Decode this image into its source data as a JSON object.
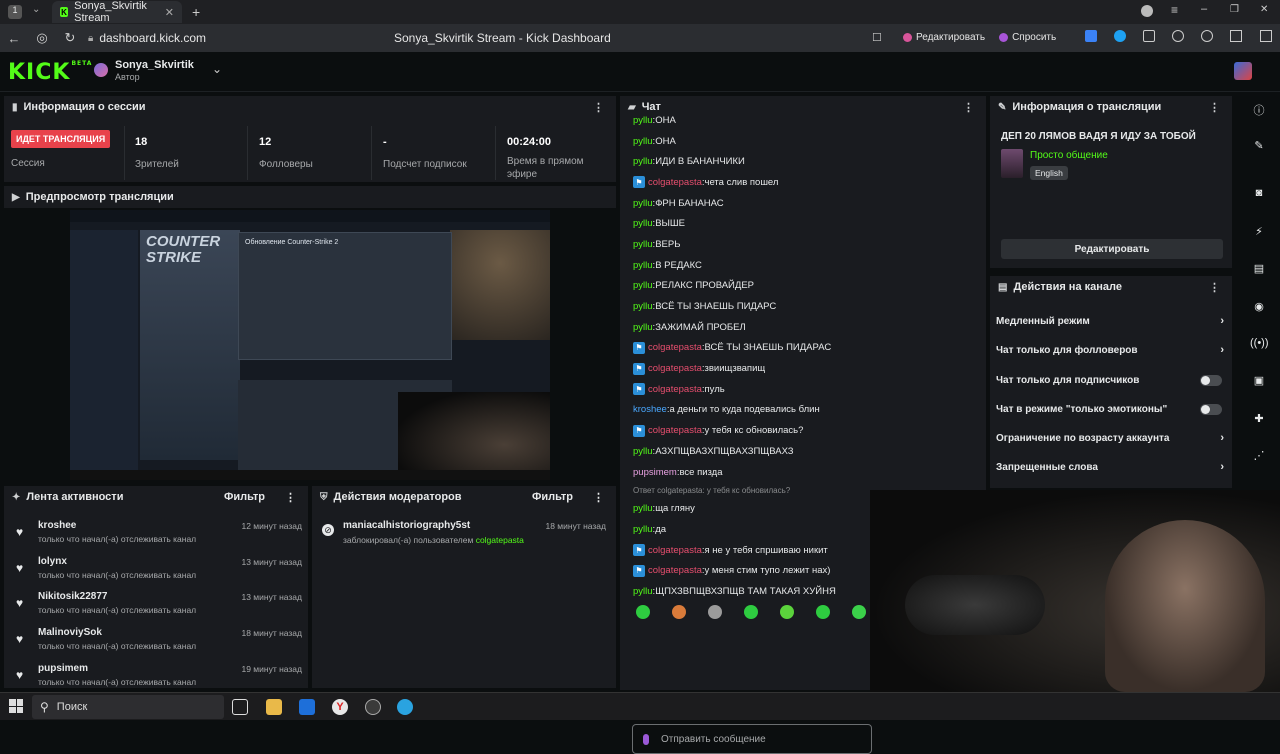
{
  "browser": {
    "tab_title": "Sonya_Skvirtik Stream",
    "url": "dashboard.kick.com",
    "page_title": "Sonya_Skvirtik Stream - Kick Dashboard",
    "edit_label": "Редактировать",
    "ask_label": "Спросить"
  },
  "header": {
    "logo": "KICK",
    "logo_badge": "BETA",
    "channel_name": "Sonya_Skvirtik",
    "role": "Автор"
  },
  "session": {
    "title": "Информация о сессии",
    "live_badge": "ИДЕТ ТРАНСЛЯЦИЯ",
    "session_label": "Сессия",
    "stats": [
      {
        "value": "18",
        "label": "Зрителей"
      },
      {
        "value": "12",
        "label": "Фолловеры"
      },
      {
        "value": "-",
        "label": "Подсчет подписок"
      },
      {
        "value": "00:24:00",
        "label": "Время в прямом эфире"
      }
    ]
  },
  "preview": {
    "title": "Предпросмотр трансляции",
    "game_text": "COUNTER STRIKE",
    "update_text": "Обновление Counter-Strike 2"
  },
  "activity": {
    "title": "Лента активности",
    "filter": "Фильтр",
    "items": [
      {
        "name": "kroshee",
        "desc": "только что начал(-а) отслеживать канал",
        "time": "12 минут назад"
      },
      {
        "name": "lolynx",
        "desc": "только что начал(-а) отслеживать канал",
        "time": "13 минут назад"
      },
      {
        "name": "Nikitosik22877",
        "desc": "только что начал(-а) отслеживать канал",
        "time": "13 минут назад"
      },
      {
        "name": "MalinoviySok",
        "desc": "только что начал(-а) отслеживать канал",
        "time": "18 минут назад"
      },
      {
        "name": "pupsimem",
        "desc": "только что начал(-а) отслеживать канал",
        "time": "19 минут назад"
      }
    ]
  },
  "mod": {
    "title": "Действия модераторов",
    "filter": "Фильтр",
    "item": {
      "name": "maniacalhistoriography5st",
      "action": "заблокировал(-а) пользователем",
      "target": "colgatepasta",
      "time": "18 минут назад"
    }
  },
  "chat": {
    "title": "Чат",
    "messages": [
      {
        "user": "pyllu",
        "color": "g",
        "badge": false,
        "text": "ОНА"
      },
      {
        "user": "pyllu",
        "color": "g",
        "badge": false,
        "text": "ОНА"
      },
      {
        "user": "pyllu",
        "color": "g",
        "badge": false,
        "text": "ИДИ В БАНАНЧИКИ"
      },
      {
        "user": "colgatepasta",
        "color": "r",
        "badge": true,
        "text": "чета слив пошел"
      },
      {
        "user": "pyllu",
        "color": "g",
        "badge": false,
        "text": "ФРН БАНАНАС"
      },
      {
        "user": "pyllu",
        "color": "g",
        "badge": false,
        "text": "ВЫШЕ"
      },
      {
        "user": "pyllu",
        "color": "g",
        "badge": false,
        "text": "ВЕРЬ"
      },
      {
        "user": "pyllu",
        "color": "g",
        "badge": false,
        "text": "В РЕДАКС"
      },
      {
        "user": "pyllu",
        "color": "g",
        "badge": false,
        "text": "РЕЛАКС ПРОВАЙДЕР"
      },
      {
        "user": "pyllu",
        "color": "g",
        "badge": false,
        "text": "ВСЁ ТЫ ЗНАЕШЬ ПИДАРС"
      },
      {
        "user": "pyllu",
        "color": "g",
        "badge": false,
        "text": "ЗАЖИМАЙ ПРОБЕЛ"
      },
      {
        "user": "colgatepasta",
        "color": "r",
        "badge": true,
        "text": "ВСЁ ТЫ ЗНАЕШЬ ПИДАРАС"
      },
      {
        "user": "colgatepasta",
        "color": "r",
        "badge": true,
        "text": "звиищзвапищ"
      },
      {
        "user": "colgatepasta",
        "color": "r",
        "badge": true,
        "text": "пуль"
      },
      {
        "user": "kroshee",
        "color": "b",
        "badge": false,
        "text": "а деньги то куда подевались блин"
      },
      {
        "user": "colgatepasta",
        "color": "r",
        "badge": true,
        "text": "у тебя кс обновилась?"
      },
      {
        "user": "pyllu",
        "color": "g",
        "badge": false,
        "text": "АЗХПЩВАЗХПЩВАХЗПЩВАХЗ"
      },
      {
        "user": "pupsimem",
        "color": "p",
        "badge": false,
        "text": "все пизда"
      }
    ],
    "reply_note": "Ответ colgatepasta: у тебя кс обновилась?",
    "messages2": [
      {
        "user": "pyllu",
        "color": "g",
        "badge": false,
        "text": "ща гляну"
      },
      {
        "user": "pyllu",
        "color": "g",
        "badge": false,
        "text": "да"
      },
      {
        "user": "colgatepasta",
        "color": "r",
        "badge": true,
        "text": "я не у тебя спршиваю никит"
      },
      {
        "user": "colgatepasta",
        "color": "r",
        "badge": true,
        "text": "у меня стим тупо лежит нах)"
      },
      {
        "user": "pyllu",
        "color": "g",
        "badge": false,
        "text": "ЩПХЗВПЩВХЗПЩВ ТАМ ТАКАЯ ХУЙНЯ"
      }
    ],
    "input_placeholder": "Отправить сообщение"
  },
  "stream_info": {
    "title": "Информация о трансляции",
    "stream_title": "ДЕП 20 ЛЯМОВ ВАДЯ Я ИДУ ЗА ТОБОЙ",
    "category": "Просто общение",
    "language": "English",
    "edit_button": "Редактировать"
  },
  "channel_actions": {
    "title": "Действия на канале",
    "items": [
      {
        "label": "Медленный режим",
        "kind": "chevron"
      },
      {
        "label": "Чат только для фолловеров",
        "kind": "chevron"
      },
      {
        "label": "Чат только для подписчиков",
        "kind": "toggle"
      },
      {
        "label": "Чат в режиме \"только эмотиконы\"",
        "kind": "toggle"
      },
      {
        "label": "Ограничение по возрасту аккаунта",
        "kind": "chevron"
      },
      {
        "label": "Запрещенные слова",
        "kind": "chevron"
      }
    ]
  },
  "taskbar": {
    "search": "Поиск"
  },
  "colors": {
    "kick_green": "#53fc18",
    "live_red": "#e8424b",
    "panel_bg": "#191b1f"
  }
}
